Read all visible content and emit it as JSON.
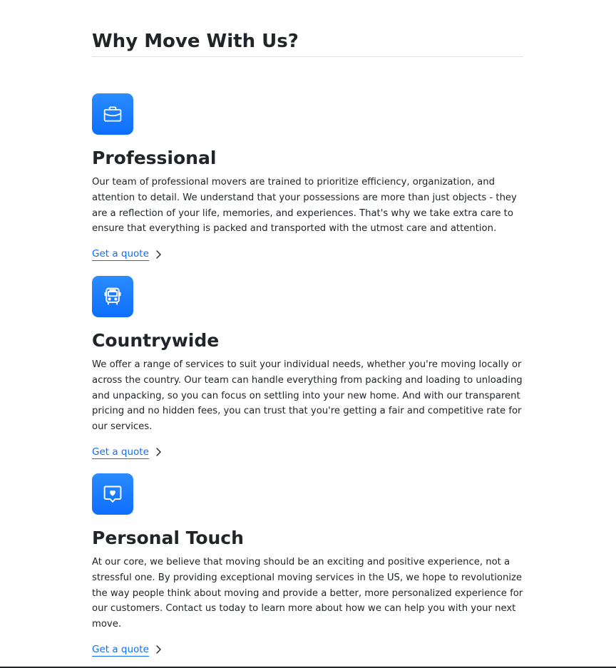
{
  "section": {
    "title": "Why Move With Us?"
  },
  "features": [
    {
      "icon": "briefcase-icon",
      "title": "Professional",
      "text": "Our team of professional movers are trained to prioritize efficiency, organization, and attention to detail. We understand that your possessions are more than just objects - they are a reflection of your life, memories, and experiences. That's why we take extra care to ensure that everything is packed and transported with the utmost care and attention.",
      "link_label": "Get a quote"
    },
    {
      "icon": "bus-icon",
      "title": "Countrywide",
      "text": "We offer a range of services to suit your individual needs, whether you're moving locally or across the country. Our team can handle everything from packing and loading to unloading and unpacking, so you can focus on settling into your new home. And with our transparent pricing and no hidden fees, you can trust that you're getting a fair and competitive rate for our services.",
      "link_label": "Get a quote"
    },
    {
      "icon": "heart-chat-icon",
      "title": "Personal Touch",
      "text": "At our core, we believe that moving should be an exciting and positive experience, not a stressful one. By providing exceptional moving services in the US, we hope to revolutionize the way people think about moving and provide a better, more personalized experience for our customers. Contact us today to learn more about how we can help you with your next move.",
      "link_label": "Get a quote"
    }
  ],
  "colors": {
    "accent": "#0d6efd",
    "text": "#212529",
    "rule": "#dee2e6"
  }
}
